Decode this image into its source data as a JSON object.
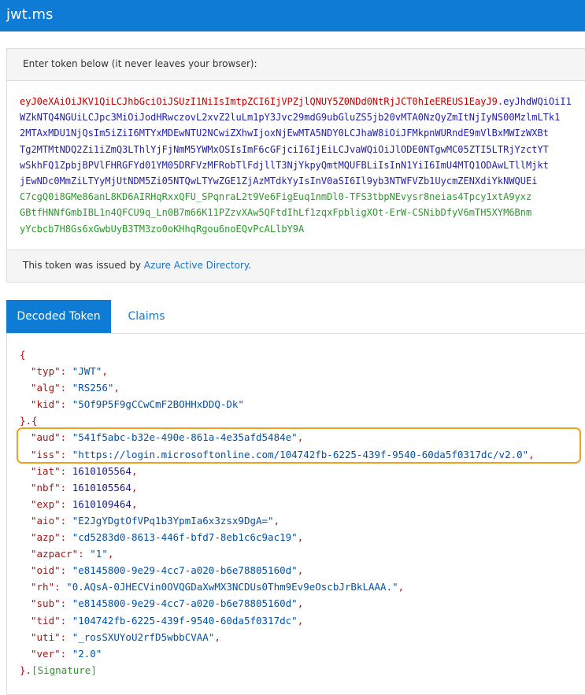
{
  "header": {
    "brand": "jwt.ms"
  },
  "token_panel": {
    "prompt": "Enter token below (it never leaves your browser):",
    "lines": [
      [
        {
          "part": "header",
          "text": "eyJ0eXAiOiJKV1QiLCJhbGciOiJSUzI1NiIsImtpZCI6IjVPZjlQNUY5Z0NDd0NtRjJCT0hIeEREUS1EayJ9."
        },
        {
          "part": "payload",
          "text": "eyJhdWQiOiI1"
        }
      ],
      [
        {
          "part": "payload",
          "text": "WZkNTQ4NGUiLCJpc3MiOiJodHRwczovL2xvZ2luLm1pY3Jvc29mdG9ubGluZS5jb20vMTA0NzQyZmItNjIyNS00MzlmLTk1"
        }
      ],
      [
        {
          "part": "payload",
          "text": "2MTAxMDU1NjQsIm5iZiI6MTYxMDEwNTU2NCwiZXhwIjoxNjEwMTA5NDY0LCJhaW8iOiJFMkpnWURndE9mVlBxMWIzWXBt"
        }
      ],
      [
        {
          "part": "payload",
          "text": "Tg2MTMtNDQ2Zi1iZmQ3LThlYjFjNmM5YWMxOSIsImF6cGFjciI6IjEiLCJvaWQiOiJlODE0NTgwMC05ZTI5LTRjYzctYT"
        }
      ],
      [
        {
          "part": "payload",
          "text": "wSkhFQ1ZpbjBPVlFHRGFYd01YM05DRFVzMFRobTlFdjllT3NjYkpyQmtMQUFBLiIsInN1YiI6ImU4MTQ1ODAwLTllMjkt"
        }
      ],
      [
        {
          "part": "payload",
          "text": "jEwNDc0MmZiLTYyMjUtNDM5Zi05NTQwLTYwZGE1ZjAzMTdkYyIsInV0aSI6Il9yb3NTWFVZb1UycmZENXdiYkNWQUEi"
        }
      ],
      [
        {
          "part": "signature",
          "text": "C7cgQ0i8GMe86anL8KD6AIRHqRxxQFU_SPqnraL2t9Ve6FigEuq1nmDl0-TFS3tbpNEvysr8neias4Tpcy1xtA9yxz"
        }
      ],
      [
        {
          "part": "signature",
          "text": "GBtfHNNfGmbIBL1n4QFCU9q_Ln0B7m66K11PZzvXAw5QFtdIhLf1zqxFpbligXOt-ErW-CSNibDfyV6mTH5XYM6Bnm"
        }
      ],
      [
        {
          "part": "signature",
          "text": "yYcbcb7H8Gs6xGwbUyB3TM3zo0oKHhqRgou6noEQvPcALlbY9A"
        }
      ]
    ],
    "issuer_prefix": "This token was issued by ",
    "issuer_link": "Azure Active Directory",
    "issuer_suffix": "."
  },
  "tabs": {
    "decoded": "Decoded Token",
    "claims": "Claims"
  },
  "decoded": {
    "open_brace": "{",
    "header_fields": [
      {
        "key": "\"typ\"",
        "value": "\"JWT\"",
        "type": "string",
        "comma": ","
      },
      {
        "key": "\"alg\"",
        "value": "\"RS256\"",
        "type": "string",
        "comma": ","
      },
      {
        "key": "\"kid\"",
        "value": "\"5Of9P5F9gCCwCmF2BOHHxDDQ-Dk\"",
        "type": "string",
        "comma": ""
      }
    ],
    "separator": "}.{",
    "payload_fields": [
      {
        "key": "\"aud\"",
        "value": "\"541f5abc-b32e-490e-861a-4e35afd5484e\"",
        "type": "string",
        "comma": ","
      },
      {
        "key": "\"iss\"",
        "value": "\"https://login.microsoftonline.com/104742fb-6225-439f-9540-60da5f0317dc/v2.0\"",
        "type": "string",
        "comma": ","
      },
      {
        "key": "\"iat\"",
        "value": "1610105564",
        "type": "number",
        "comma": ","
      },
      {
        "key": "\"nbf\"",
        "value": "1610105564",
        "type": "number",
        "comma": ","
      },
      {
        "key": "\"exp\"",
        "value": "1610109464",
        "type": "number",
        "comma": ","
      },
      {
        "key": "\"aio\"",
        "value": "\"E2JgYDgtOfVPq1b3YpmIa6x3zsx9DgA=\"",
        "type": "string",
        "comma": ","
      },
      {
        "key": "\"azp\"",
        "value": "\"cd5283d0-8613-446f-bfd7-8eb1c6c9ac19\"",
        "type": "string",
        "comma": ","
      },
      {
        "key": "\"azpacr\"",
        "value": "\"1\"",
        "type": "string",
        "comma": ","
      },
      {
        "key": "\"oid\"",
        "value": "\"e8145800-9e29-4cc7-a020-b6e78805160d\"",
        "type": "string",
        "comma": ","
      },
      {
        "key": "\"rh\"",
        "value": "\"0.AQsA-0JHECVin0OVQGDaXwMX3NCDUs0Thm9Ev9eOscbJrBkLAAA.\"",
        "type": "string",
        "comma": ","
      },
      {
        "key": "\"sub\"",
        "value": "\"e8145800-9e29-4cc7-a020-b6e78805160d\"",
        "type": "string",
        "comma": ","
      },
      {
        "key": "\"tid\"",
        "value": "\"104742fb-6225-439f-9540-60da5f0317dc\"",
        "type": "string",
        "comma": ","
      },
      {
        "key": "\"uti\"",
        "value": "\"_rosSXUYoU2rfD5wbbCVAA\"",
        "type": "string",
        "comma": ","
      },
      {
        "key": "\"ver\"",
        "value": "\"2.0\"",
        "type": "string",
        "comma": ""
      }
    ],
    "close": "}.",
    "signature": "[Signature]"
  },
  "colors": {
    "accent": "#0e7bd4",
    "token_header": "#c00000",
    "token_payload": "#2222aa",
    "token_signature": "#2a9a2a",
    "highlight": "#f0a020"
  }
}
